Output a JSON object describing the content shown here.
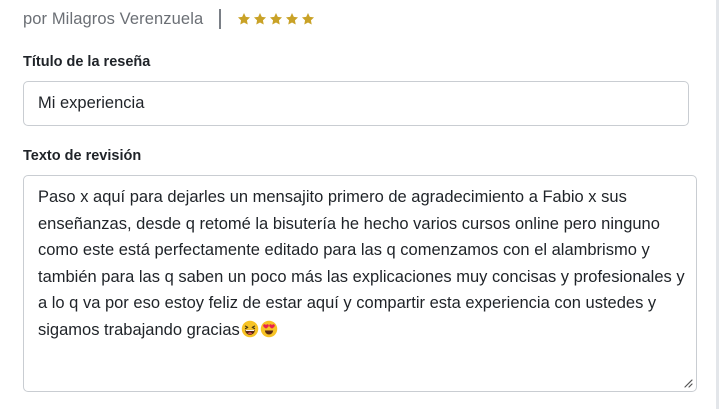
{
  "review": {
    "author": "por Milagros Verenzuela",
    "rating": 5,
    "star_color": "#c9a227",
    "title_label": "Título de la reseña",
    "title_value": "Mi experiencia",
    "body_label": "Texto de revisión",
    "body_value": "Paso x aquí para dejarles un mensajito primero de agradecimiento a Fabio x sus enseñanzas, desde q retomé la bisutería he hecho varios cursos online pero ninguno como este está perfectamente editado para las q comenzamos con el alambrismo y también para las q saben un poco más las explicaciones muy concisas y profesionales y a lo q va por eso estoy feliz de estar aquí y compartir esta experiencia con ustedes y sigamos trabajando gracias",
    "body_emojis": [
      "grinning-squinting-face-emoji",
      "heart-eyes-face-emoji"
    ]
  }
}
